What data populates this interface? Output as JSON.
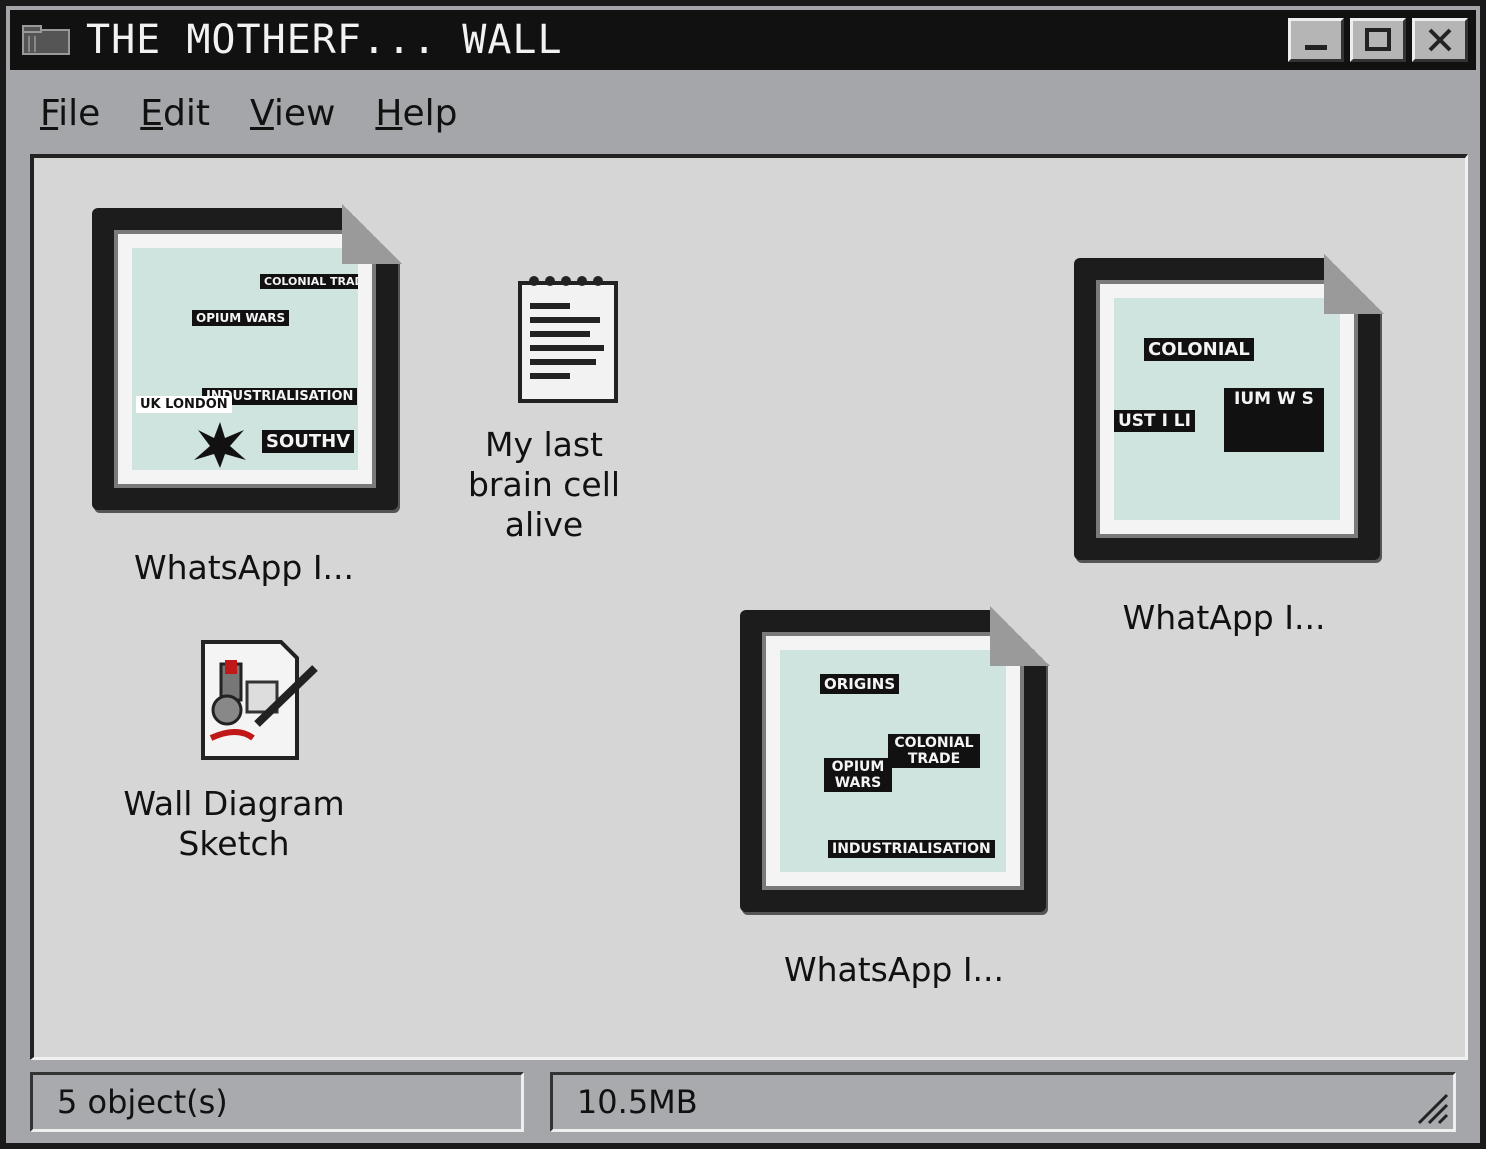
{
  "window": {
    "title": "THE MOTHERF... WALL",
    "controls": [
      "minimize",
      "maximize",
      "close"
    ]
  },
  "menu": {
    "file": "File",
    "edit": "Edit",
    "view": "View",
    "help": "Help"
  },
  "files": [
    {
      "label": "WhatsApp I...",
      "type": "image",
      "icon": "photo-file-icon",
      "tags": [
        "COLONIAL TRADE",
        "OPIUM WARS",
        "INDUSTRIALISATION",
        "UK LONDON",
        "SOUTHV"
      ]
    },
    {
      "label": "My last brain cell alive",
      "type": "text",
      "icon": "notepad-icon"
    },
    {
      "label": "WhatApp I...",
      "type": "image",
      "icon": "photo-file-icon",
      "tags": [
        "COLONIAL",
        "IUM W S",
        "UST I LI"
      ]
    },
    {
      "label": "Wall Diagram Sketch",
      "type": "drawing",
      "icon": "paint-file-icon"
    },
    {
      "label": "WhatsApp I...",
      "type": "image",
      "icon": "photo-file-icon",
      "tags": [
        "ORIGINS",
        "COLONIAL TRADE",
        "OPIUM WARS",
        "INDUSTRIALISATION"
      ]
    }
  ],
  "status": {
    "objects": "5 object(s)",
    "size": "10.5MB"
  }
}
